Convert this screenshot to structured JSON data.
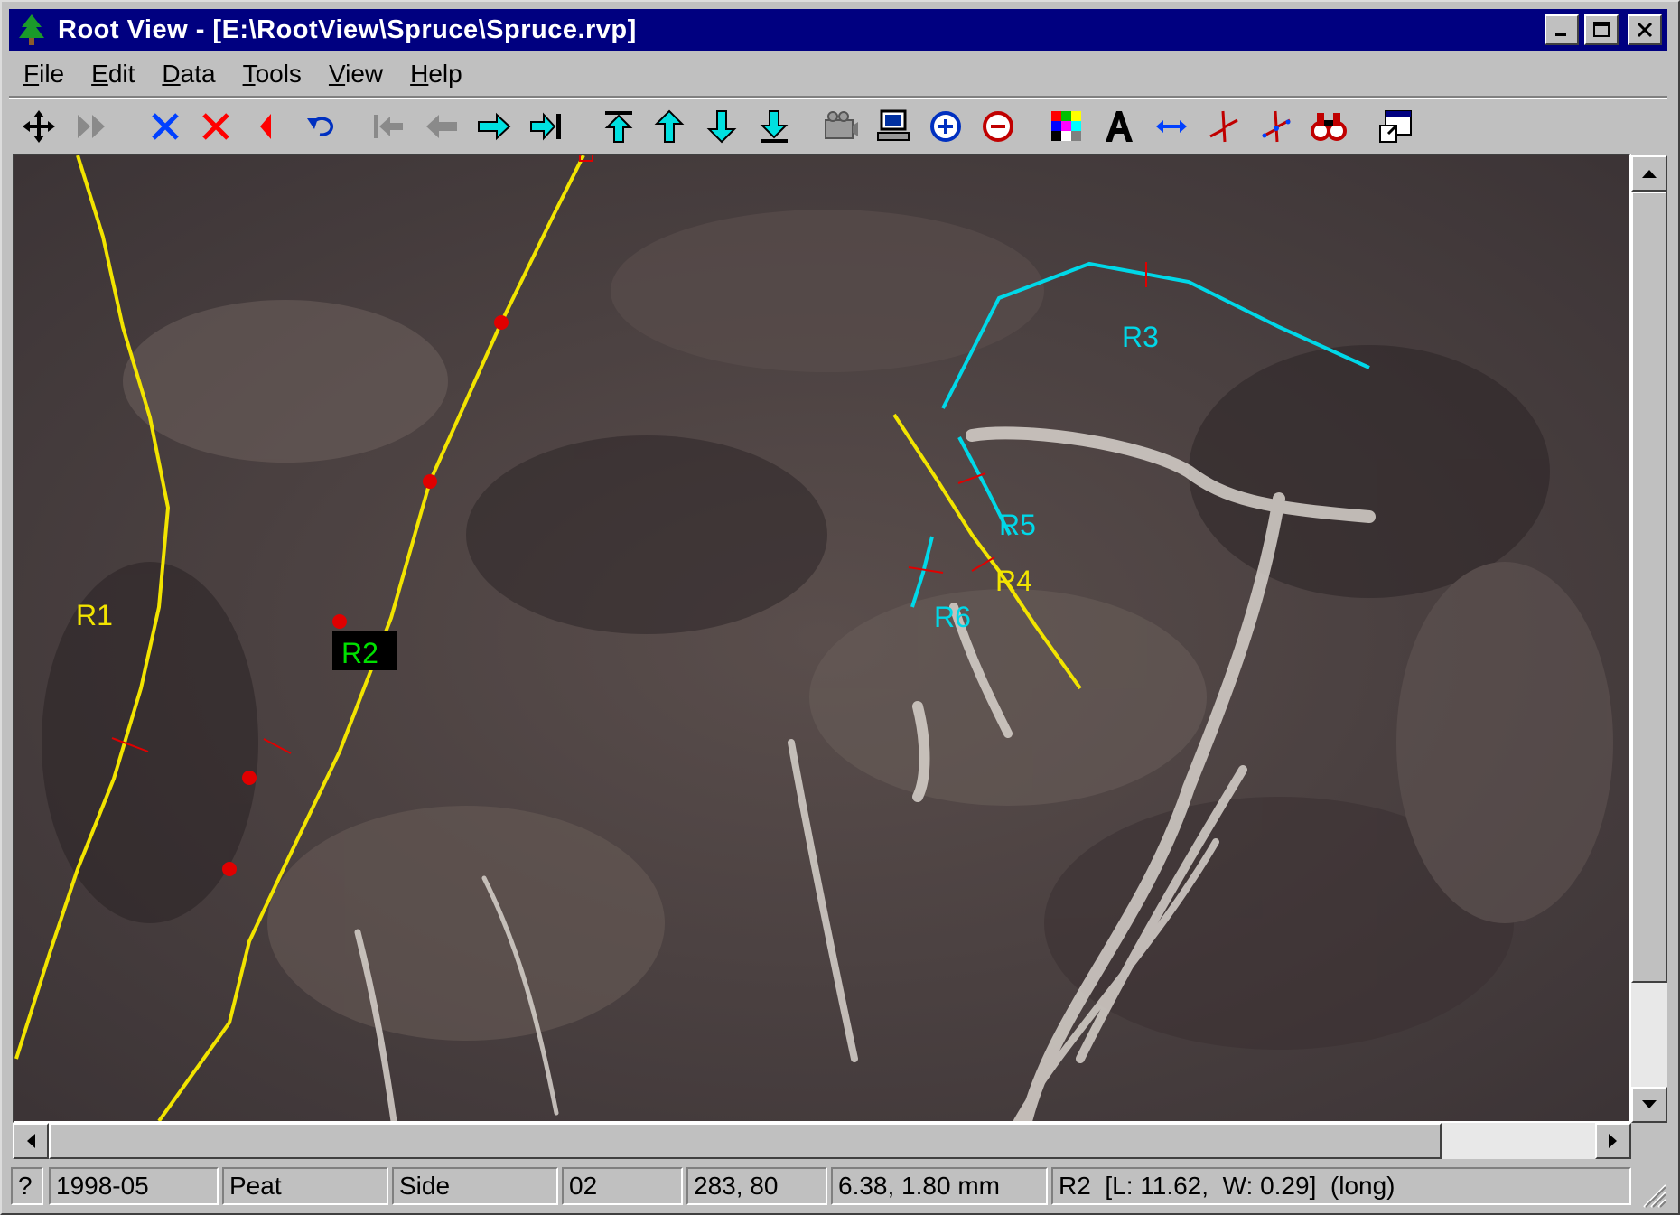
{
  "window": {
    "title": "Root View - [E:\\RootView\\Spruce\\Spruce.rvp]"
  },
  "titlebar_buttons": [
    "minimize-icon",
    "maximize-icon",
    "close-icon"
  ],
  "menu": [
    {
      "label": "File",
      "mnemonic": "F",
      "rest": "ile"
    },
    {
      "label": "Edit",
      "mnemonic": "E",
      "rest": "dit"
    },
    {
      "label": "Data",
      "mnemonic": "D",
      "rest": "ata"
    },
    {
      "label": "Tools",
      "mnemonic": "T",
      "rest": "ools"
    },
    {
      "label": "View",
      "mnemonic": "V",
      "rest": "iew"
    },
    {
      "label": "Help",
      "mnemonic": "H",
      "rest": "elp"
    }
  ],
  "toolbar": [
    "move-icon",
    "fast-forward-icon",
    "delete-blue-x-icon",
    "delete-red-x-icon",
    "red-triangle-left-icon",
    "undo-icon",
    "first-frame-icon",
    "previous-frame-icon",
    "next-frame-icon",
    "last-frame-icon",
    "top-icon",
    "up-icon",
    "down-icon",
    "bottom-icon",
    "camera-icon",
    "computer-icon",
    "zoom-in-icon",
    "zoom-out-icon",
    "color-grid-icon",
    "text-icon",
    "measure-width-icon",
    "branch-icon",
    "branch-points-icon",
    "binoculars-icon",
    "window-export-icon"
  ],
  "roots": [
    {
      "label": "R1",
      "color": "#f2e400"
    },
    {
      "label": "R2",
      "color": "#00e000"
    },
    {
      "label": "R3",
      "color": "#00d8e8"
    },
    {
      "label": "R4",
      "color": "#f2e400"
    },
    {
      "label": "R5",
      "color": "#00d8e8"
    },
    {
      "label": "R6",
      "color": "#00d8e8"
    }
  ],
  "colors": {
    "yellow_root": "#f2e400",
    "cyan_root": "#00d8e8",
    "node_marker": "#e00000",
    "title_bar": "#000080"
  },
  "status": {
    "help": "?",
    "date": "1998-05",
    "medium": "Peat",
    "side": "Side",
    "frame": "02",
    "pixel_coords": "283, 80",
    "mm_coords": "6.38, 1.80 mm",
    "selection": "R2  [L: 11.62,  W: 0.29]  (long)"
  }
}
